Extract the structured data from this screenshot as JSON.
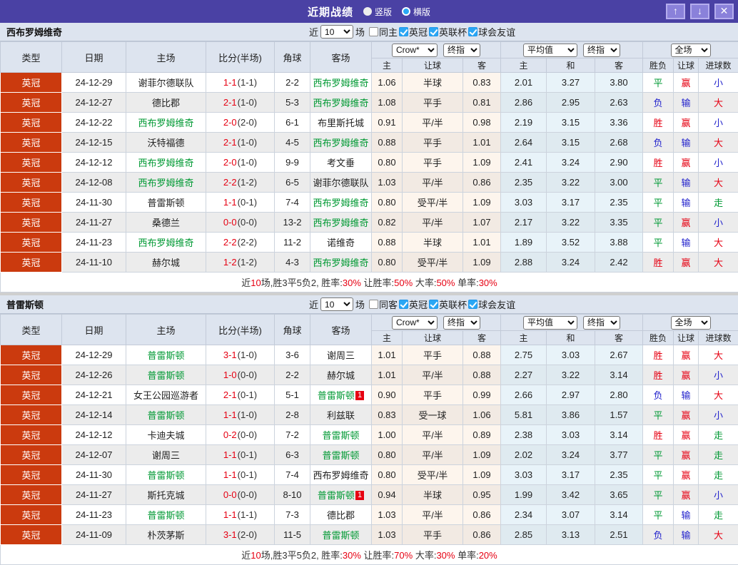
{
  "titlebar": {
    "title": "近期战绩",
    "radio_options": [
      {
        "label": "竖版",
        "selected": true
      },
      {
        "label": "横版",
        "selected": false
      }
    ],
    "buttons": {
      "up": "↑",
      "down": "↓",
      "close": "✕"
    }
  },
  "colors": {
    "titlebar_bg": "#4a41a4",
    "header_bg": "#dde4ef",
    "league_badge_bg": "#cb3a0e",
    "self_team_green": "#009933",
    "win_red": "#e60012",
    "lose_blue": "#2222cc",
    "checkbox_blue": "#2aa7f5"
  },
  "table_header": {
    "cols": [
      "类型",
      "日期",
      "主场",
      "比分(半场)",
      "角球",
      "客场"
    ],
    "dd_crow": "Crow*",
    "dd_final": "终指",
    "dd_avg": "平均值",
    "dd_full": "全场",
    "sub": [
      "主",
      "让球",
      "客",
      "主",
      "和",
      "客",
      "胜负",
      "让球",
      "进球数"
    ]
  },
  "sections": [
    {
      "team": "西布罗姆维奇",
      "filter": {
        "near": "近",
        "games": "10",
        "games_suffix": "场",
        "same": "同主",
        "same_checked": false,
        "comps": [
          {
            "label": "英冠",
            "checked": true
          },
          {
            "label": "英联杯",
            "checked": true
          },
          {
            "label": "球会友谊",
            "checked": true
          }
        ]
      },
      "rows": [
        {
          "league": "英冠",
          "date": "24-12-29",
          "home": "谢菲尔德联队",
          "home_self": false,
          "home_card": "",
          "score": "1-1",
          "half": "(1-1)",
          "corner": "2-2",
          "away": "西布罗姆维奇",
          "away_self": true,
          "away_card": "",
          "crow": [
            "1.06",
            "半球",
            "0.83"
          ],
          "avg": [
            "2.01",
            "3.27",
            "3.80"
          ],
          "outcome": [
            [
              "平",
              "g"
            ],
            [
              "赢",
              "r"
            ],
            [
              "小",
              "b"
            ]
          ]
        },
        {
          "league": "英冠",
          "date": "24-12-27",
          "home": "德比郡",
          "home_self": false,
          "home_card": "",
          "score": "2-1",
          "half": "(1-0)",
          "corner": "5-3",
          "away": "西布罗姆维奇",
          "away_self": true,
          "away_card": "",
          "crow": [
            "1.08",
            "平手",
            "0.81"
          ],
          "avg": [
            "2.86",
            "2.95",
            "2.63"
          ],
          "outcome": [
            [
              "负",
              "b"
            ],
            [
              "输",
              "b"
            ],
            [
              "大",
              "r"
            ]
          ]
        },
        {
          "league": "英冠",
          "date": "24-12-22",
          "home": "西布罗姆维奇",
          "home_self": true,
          "home_card": "",
          "score": "2-0",
          "half": "(2-0)",
          "corner": "6-1",
          "away": "布里斯托城",
          "away_self": false,
          "away_card": "",
          "crow": [
            "0.91",
            "平/半",
            "0.98"
          ],
          "avg": [
            "2.19",
            "3.15",
            "3.36"
          ],
          "outcome": [
            [
              "胜",
              "r"
            ],
            [
              "赢",
              "r"
            ],
            [
              "小",
              "b"
            ]
          ]
        },
        {
          "league": "英冠",
          "date": "24-12-15",
          "home": "沃特福德",
          "home_self": false,
          "home_card": "",
          "score": "2-1",
          "half": "(1-0)",
          "corner": "4-5",
          "away": "西布罗姆维奇",
          "away_self": true,
          "away_card": "",
          "crow": [
            "0.88",
            "平手",
            "1.01"
          ],
          "avg": [
            "2.64",
            "3.15",
            "2.68"
          ],
          "outcome": [
            [
              "负",
              "b"
            ],
            [
              "输",
              "b"
            ],
            [
              "大",
              "r"
            ]
          ]
        },
        {
          "league": "英冠",
          "date": "24-12-12",
          "home": "西布罗姆维奇",
          "home_self": true,
          "home_card": "",
          "score": "2-0",
          "half": "(1-0)",
          "corner": "9-9",
          "away": "考文垂",
          "away_self": false,
          "away_card": "",
          "crow": [
            "0.80",
            "平手",
            "1.09"
          ],
          "avg": [
            "2.41",
            "3.24",
            "2.90"
          ],
          "outcome": [
            [
              "胜",
              "r"
            ],
            [
              "赢",
              "r"
            ],
            [
              "小",
              "b"
            ]
          ]
        },
        {
          "league": "英冠",
          "date": "24-12-08",
          "home": "西布罗姆维奇",
          "home_self": true,
          "home_card": "",
          "score": "2-2",
          "half": "(1-2)",
          "corner": "6-5",
          "away": "谢菲尔德联队",
          "away_self": false,
          "away_card": "",
          "crow": [
            "1.03",
            "平/半",
            "0.86"
          ],
          "avg": [
            "2.35",
            "3.22",
            "3.00"
          ],
          "outcome": [
            [
              "平",
              "g"
            ],
            [
              "输",
              "b"
            ],
            [
              "大",
              "r"
            ]
          ]
        },
        {
          "league": "英冠",
          "date": "24-11-30",
          "home": "普雷斯顿",
          "home_self": false,
          "home_card": "",
          "score": "1-1",
          "half": "(0-1)",
          "corner": "7-4",
          "away": "西布罗姆维奇",
          "away_self": true,
          "away_card": "",
          "crow": [
            "0.80",
            "受平/半",
            "1.09"
          ],
          "avg": [
            "3.03",
            "3.17",
            "2.35"
          ],
          "outcome": [
            [
              "平",
              "g"
            ],
            [
              "输",
              "b"
            ],
            [
              "走",
              "g"
            ]
          ]
        },
        {
          "league": "英冠",
          "date": "24-11-27",
          "home": "桑德兰",
          "home_self": false,
          "home_card": "",
          "score": "0-0",
          "half": "(0-0)",
          "corner": "13-2",
          "away": "西布罗姆维奇",
          "away_self": true,
          "away_card": "",
          "crow": [
            "0.82",
            "平/半",
            "1.07"
          ],
          "avg": [
            "2.17",
            "3.22",
            "3.35"
          ],
          "outcome": [
            [
              "平",
              "g"
            ],
            [
              "赢",
              "r"
            ],
            [
              "小",
              "b"
            ]
          ]
        },
        {
          "league": "英冠",
          "date": "24-11-23",
          "home": "西布罗姆维奇",
          "home_self": true,
          "home_card": "",
          "score": "2-2",
          "half": "(2-2)",
          "corner": "11-2",
          "away": "诺维奇",
          "away_self": false,
          "away_card": "",
          "crow": [
            "0.88",
            "半球",
            "1.01"
          ],
          "avg": [
            "1.89",
            "3.52",
            "3.88"
          ],
          "outcome": [
            [
              "平",
              "g"
            ],
            [
              "输",
              "b"
            ],
            [
              "大",
              "r"
            ]
          ]
        },
        {
          "league": "英冠",
          "date": "24-11-10",
          "home": "赫尔城",
          "home_self": false,
          "home_card": "",
          "score": "1-2",
          "half": "(1-2)",
          "corner": "4-3",
          "away": "西布罗姆维奇",
          "away_self": true,
          "away_card": "",
          "crow": [
            "0.80",
            "受平/半",
            "1.09"
          ],
          "avg": [
            "2.88",
            "3.24",
            "2.42"
          ],
          "outcome": [
            [
              "胜",
              "r"
            ],
            [
              "赢",
              "r"
            ],
            [
              "大",
              "r"
            ]
          ]
        }
      ],
      "summary": [
        [
          "近",
          0
        ],
        [
          "10",
          1
        ],
        [
          "场,胜3平5负2, 胜率:",
          0
        ],
        [
          "30%",
          1
        ],
        [
          " 让胜率:",
          0
        ],
        [
          "50%",
          1
        ],
        [
          " 大率:",
          0
        ],
        [
          "50%",
          1
        ],
        [
          " 单率:",
          0
        ],
        [
          "30%",
          1
        ]
      ]
    },
    {
      "team": "普雷斯顿",
      "filter": {
        "near": "近",
        "games": "10",
        "games_suffix": "场",
        "same": "同客",
        "same_checked": false,
        "comps": [
          {
            "label": "英冠",
            "checked": true
          },
          {
            "label": "英联杯",
            "checked": true
          },
          {
            "label": "球会友谊",
            "checked": true
          }
        ]
      },
      "rows": [
        {
          "league": "英冠",
          "date": "24-12-29",
          "home": "普雷斯顿",
          "home_self": true,
          "home_card": "",
          "score": "3-1",
          "half": "(1-0)",
          "corner": "3-6",
          "away": "谢周三",
          "away_self": false,
          "away_card": "",
          "crow": [
            "1.01",
            "平手",
            "0.88"
          ],
          "avg": [
            "2.75",
            "3.03",
            "2.67"
          ],
          "outcome": [
            [
              "胜",
              "r"
            ],
            [
              "赢",
              "r"
            ],
            [
              "大",
              "r"
            ]
          ]
        },
        {
          "league": "英冠",
          "date": "24-12-26",
          "home": "普雷斯顿",
          "home_self": true,
          "home_card": "",
          "score": "1-0",
          "half": "(0-0)",
          "corner": "2-2",
          "away": "赫尔城",
          "away_self": false,
          "away_card": "",
          "crow": [
            "1.01",
            "平/半",
            "0.88"
          ],
          "avg": [
            "2.27",
            "3.22",
            "3.14"
          ],
          "outcome": [
            [
              "胜",
              "r"
            ],
            [
              "赢",
              "r"
            ],
            [
              "小",
              "b"
            ]
          ]
        },
        {
          "league": "英冠",
          "date": "24-12-21",
          "home": "女王公园巡游者",
          "home_self": false,
          "home_card": "",
          "score": "2-1",
          "half": "(0-1)",
          "corner": "5-1",
          "away": "普雷斯顿",
          "away_self": true,
          "away_card": "1",
          "crow": [
            "0.90",
            "平手",
            "0.99"
          ],
          "avg": [
            "2.66",
            "2.97",
            "2.80"
          ],
          "outcome": [
            [
              "负",
              "b"
            ],
            [
              "输",
              "b"
            ],
            [
              "大",
              "r"
            ]
          ]
        },
        {
          "league": "英冠",
          "date": "24-12-14",
          "home": "普雷斯顿",
          "home_self": true,
          "home_card": "",
          "score": "1-1",
          "half": "(1-0)",
          "corner": "2-8",
          "away": "利兹联",
          "away_self": false,
          "away_card": "",
          "crow": [
            "0.83",
            "受一球",
            "1.06"
          ],
          "avg": [
            "5.81",
            "3.86",
            "1.57"
          ],
          "outcome": [
            [
              "平",
              "g"
            ],
            [
              "赢",
              "r"
            ],
            [
              "小",
              "b"
            ]
          ]
        },
        {
          "league": "英冠",
          "date": "24-12-12",
          "home": "卡迪夫城",
          "home_self": false,
          "home_card": "",
          "score": "0-2",
          "half": "(0-0)",
          "corner": "7-2",
          "away": "普雷斯顿",
          "away_self": true,
          "away_card": "",
          "crow": [
            "1.00",
            "平/半",
            "0.89"
          ],
          "avg": [
            "2.38",
            "3.03",
            "3.14"
          ],
          "outcome": [
            [
              "胜",
              "r"
            ],
            [
              "赢",
              "r"
            ],
            [
              "走",
              "g"
            ]
          ]
        },
        {
          "league": "英冠",
          "date": "24-12-07",
          "home": "谢周三",
          "home_self": false,
          "home_card": "",
          "score": "1-1",
          "half": "(0-1)",
          "corner": "6-3",
          "away": "普雷斯顿",
          "away_self": true,
          "away_card": "",
          "crow": [
            "0.80",
            "平/半",
            "1.09"
          ],
          "avg": [
            "2.02",
            "3.24",
            "3.77"
          ],
          "outcome": [
            [
              "平",
              "g"
            ],
            [
              "赢",
              "r"
            ],
            [
              "走",
              "g"
            ]
          ]
        },
        {
          "league": "英冠",
          "date": "24-11-30",
          "home": "普雷斯顿",
          "home_self": true,
          "home_card": "",
          "score": "1-1",
          "half": "(0-1)",
          "corner": "7-4",
          "away": "西布罗姆维奇",
          "away_self": false,
          "away_card": "",
          "crow": [
            "0.80",
            "受平/半",
            "1.09"
          ],
          "avg": [
            "3.03",
            "3.17",
            "2.35"
          ],
          "outcome": [
            [
              "平",
              "g"
            ],
            [
              "赢",
              "r"
            ],
            [
              "走",
              "g"
            ]
          ]
        },
        {
          "league": "英冠",
          "date": "24-11-27",
          "home": "斯托克城",
          "home_self": false,
          "home_card": "",
          "score": "0-0",
          "half": "(0-0)",
          "corner": "8-10",
          "away": "普雷斯顿",
          "away_self": true,
          "away_card": "1",
          "crow": [
            "0.94",
            "半球",
            "0.95"
          ],
          "avg": [
            "1.99",
            "3.42",
            "3.65"
          ],
          "outcome": [
            [
              "平",
              "g"
            ],
            [
              "赢",
              "r"
            ],
            [
              "小",
              "b"
            ]
          ]
        },
        {
          "league": "英冠",
          "date": "24-11-23",
          "home": "普雷斯顿",
          "home_self": true,
          "home_card": "",
          "score": "1-1",
          "half": "(1-1)",
          "corner": "7-3",
          "away": "德比郡",
          "away_self": false,
          "away_card": "",
          "crow": [
            "1.03",
            "平/半",
            "0.86"
          ],
          "avg": [
            "2.34",
            "3.07",
            "3.14"
          ],
          "outcome": [
            [
              "平",
              "g"
            ],
            [
              "输",
              "b"
            ],
            [
              "走",
              "g"
            ]
          ]
        },
        {
          "league": "英冠",
          "date": "24-11-09",
          "home": "朴茨茅斯",
          "home_self": false,
          "home_card": "",
          "score": "3-1",
          "half": "(2-0)",
          "corner": "11-5",
          "away": "普雷斯顿",
          "away_self": true,
          "away_card": "",
          "crow": [
            "1.03",
            "平手",
            "0.86"
          ],
          "avg": [
            "2.85",
            "3.13",
            "2.51"
          ],
          "outcome": [
            [
              "负",
              "b"
            ],
            [
              "输",
              "b"
            ],
            [
              "大",
              "r"
            ]
          ]
        }
      ],
      "summary": [
        [
          "近",
          0
        ],
        [
          "10",
          1
        ],
        [
          "场,胜3平5负2, 胜率:",
          0
        ],
        [
          "30%",
          1
        ],
        [
          " 让胜率:",
          0
        ],
        [
          "70%",
          1
        ],
        [
          " 大率:",
          0
        ],
        [
          "30%",
          1
        ],
        [
          " 单率:",
          0
        ],
        [
          "20%",
          1
        ]
      ]
    }
  ]
}
